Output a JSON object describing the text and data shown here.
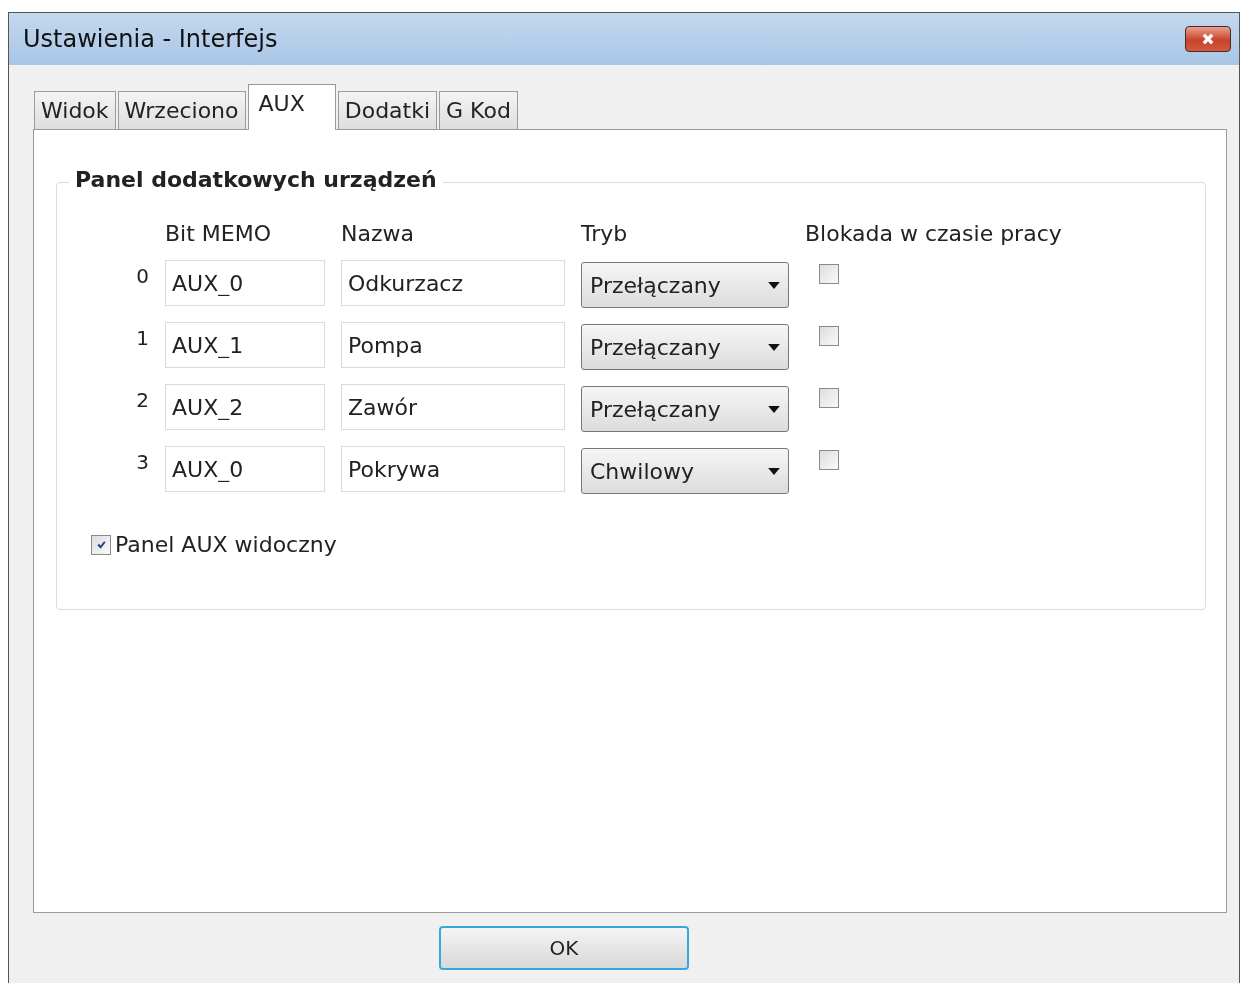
{
  "window": {
    "title": "Ustawienia - Interfejs"
  },
  "tabs": [
    {
      "label": "Widok",
      "selected": false
    },
    {
      "label": "Wrzeciono",
      "selected": false
    },
    {
      "label": "AUX",
      "selected": true
    },
    {
      "label": "Dodatki",
      "selected": false
    },
    {
      "label": "G Kod",
      "selected": false
    }
  ],
  "group": {
    "title": "Panel dodatkowych urządzeń",
    "columns": [
      "Bit MEMO",
      "Nazwa",
      "Tryb",
      "Blokada w czasie pracy"
    ],
    "rows": [
      {
        "index": "0",
        "bit": "AUX_0",
        "name": "Odkurzacz",
        "mode": "Przełączany",
        "locked": false
      },
      {
        "index": "1",
        "bit": "AUX_1",
        "name": "Pompa",
        "mode": "Przełączany",
        "locked": false
      },
      {
        "index": "2",
        "bit": "AUX_2",
        "name": "Zawór",
        "mode": "Przełączany",
        "locked": false
      },
      {
        "index": "3",
        "bit": "AUX_0",
        "name": "Pokrywa",
        "mode": "Chwilowy",
        "locked": false
      }
    ],
    "visible_option": {
      "label": "Panel AUX widoczny",
      "checked": true
    }
  },
  "buttons": [
    {
      "label": "OK"
    }
  ]
}
